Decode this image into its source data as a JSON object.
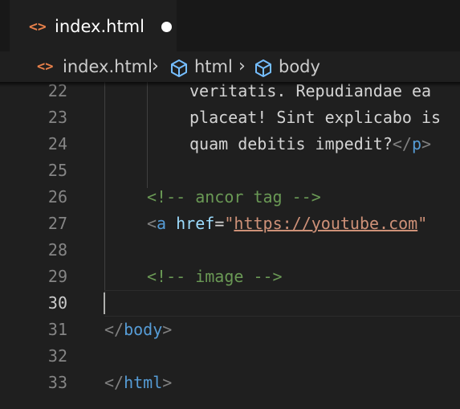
{
  "tab": {
    "label": "index.html",
    "icon": "html-file-icon",
    "modified": true
  },
  "breadcrumb": [
    "index.html",
    "html",
    "body"
  ],
  "editor": {
    "active_line": "30",
    "lines": [
      {
        "num": "22",
        "text": "veritatis. Repudiandae ea"
      },
      {
        "num": "23",
        "text": "placeat! Sint explicabo is"
      },
      {
        "num": "24",
        "text_a": "quam debitis impedit?",
        "tag_open": "</",
        "tag_name": "p",
        "tag_close": ">"
      },
      {
        "num": "25",
        "text": ""
      },
      {
        "num": "26",
        "text": "<!-- ancor tag -->"
      },
      {
        "num": "27",
        "lt": "<",
        "tag": "a",
        "attr": "href",
        "eq": "=",
        "q": "\"",
        "url": "https://youtube.com",
        "q2": "\""
      },
      {
        "num": "28",
        "text": ""
      },
      {
        "num": "29",
        "text": "<!-- image -->"
      },
      {
        "num": "30",
        "text": ""
      },
      {
        "num": "31",
        "open": "</",
        "tag": "body",
        "close": ">"
      },
      {
        "num": "32",
        "text": ""
      },
      {
        "num": "33",
        "open": "</",
        "tag": "html",
        "close": ">"
      }
    ]
  },
  "colors": {
    "background": "#1f1f1f",
    "tag": "#569cd6",
    "comment": "#6a9955",
    "string": "#ce9178",
    "attribute": "#9cdcfe"
  }
}
